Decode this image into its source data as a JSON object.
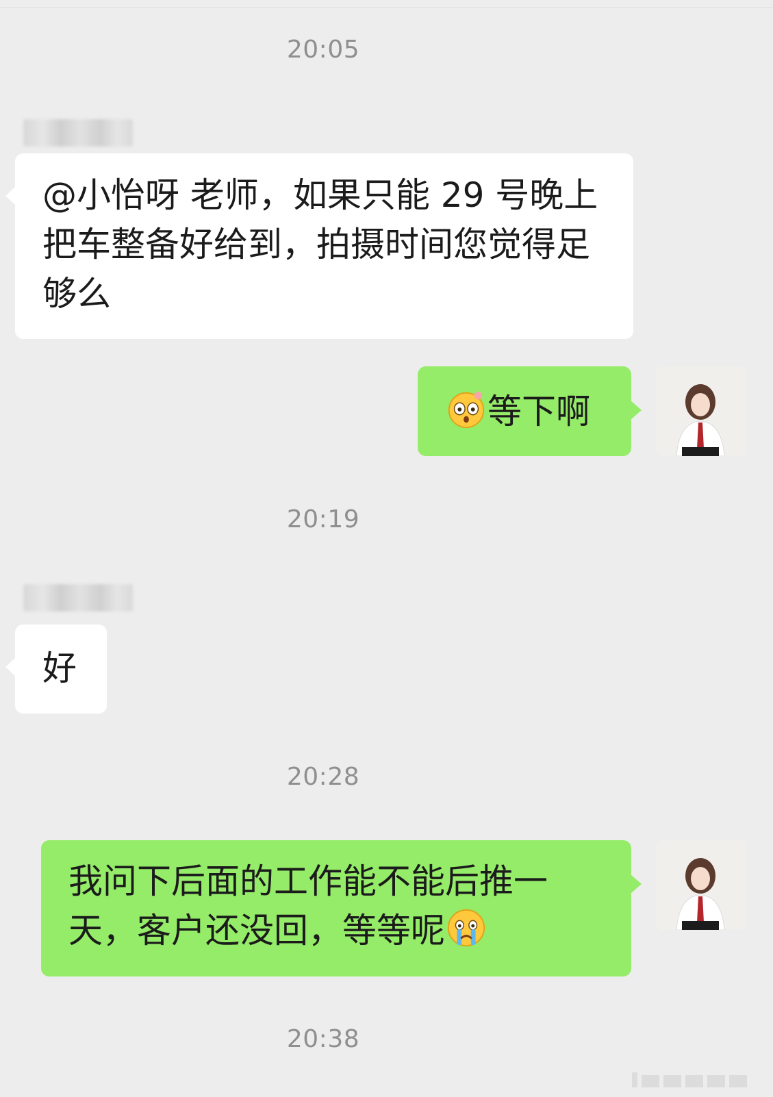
{
  "chat": {
    "messages": [
      {
        "type": "time",
        "text": "20:05"
      },
      {
        "type": "incoming",
        "sender_name": "blurred",
        "text": "@小怡呀 老师，如果只能 29 号晚上把车整备好给到，拍摄时间您觉得足够么"
      },
      {
        "type": "outgoing",
        "emoji": "flushed-face-emoji",
        "text": "等下啊"
      },
      {
        "type": "time",
        "text": "20:19"
      },
      {
        "type": "incoming",
        "sender_name": "blurred",
        "text": "好"
      },
      {
        "type": "time",
        "text": "20:28"
      },
      {
        "type": "outgoing",
        "text": "我问下后面的工作能不能后推一天，客户还没回，等等呢",
        "emoji": "crying-face-emoji"
      },
      {
        "type": "time",
        "text": "20:38"
      }
    ]
  },
  "colors": {
    "background": "#ededed",
    "incoming_bubble": "#ffffff",
    "outgoing_bubble": "#95ec69",
    "timestamp_text": "#8f8f8f"
  },
  "icons": {
    "avatar": "user-avatar-photo",
    "emoji_1": "flushed-face-emoji",
    "emoji_2": "crying-face-emoji"
  }
}
